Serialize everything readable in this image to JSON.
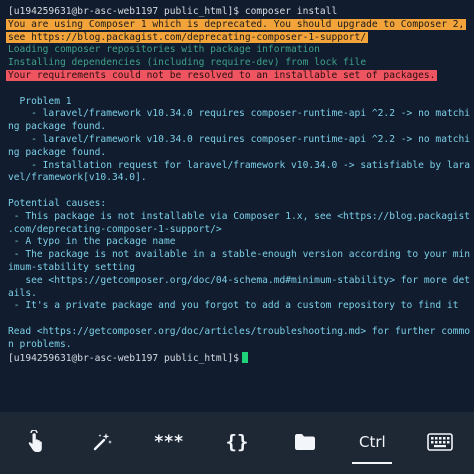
{
  "terminal": {
    "lines": [
      {
        "text": "[u194259631@br-asc-web1197 public_html]$ composer install",
        "style": "plain"
      },
      {
        "text": "You are using Composer 1 which is deprecated. You should upgrade to Composer 2,",
        "style": "warn"
      },
      {
        "text": "see https://blog.packagist.com/deprecating-composer-1-support/",
        "style": "warn"
      },
      {
        "text": "Loading composer repositories with package information",
        "style": "dim"
      },
      {
        "text": "Installing dependencies (including require-dev) from lock file",
        "style": "dim"
      },
      {
        "text": "Your requirements could not be resolved to an installable set of packages.",
        "style": "err"
      },
      {
        "text": "",
        "style": "plain"
      },
      {
        "text": "  Problem 1",
        "style": "cyan"
      },
      {
        "text": "    - laravel/framework v10.34.0 requires composer-runtime-api ^2.2 -> no matchi",
        "style": "cyan"
      },
      {
        "text": "ng package found.",
        "style": "cyan"
      },
      {
        "text": "    - laravel/framework v10.34.0 requires composer-runtime-api ^2.2 -> no matchi",
        "style": "cyan"
      },
      {
        "text": "ng package found.",
        "style": "cyan"
      },
      {
        "text": "    - Installation request for laravel/framework v10.34.0 -> satisfiable by lara",
        "style": "cyan"
      },
      {
        "text": "vel/framework[v10.34.0].",
        "style": "cyan"
      },
      {
        "text": "",
        "style": "plain"
      },
      {
        "text": "Potential causes:",
        "style": "cyan"
      },
      {
        "text": " - This package is not installable via Composer 1.x, see <https://blog.packagist",
        "style": "cyan"
      },
      {
        "text": ".com/deprecating-composer-1-support/>",
        "style": "cyan"
      },
      {
        "text": " - A typo in the package name",
        "style": "cyan"
      },
      {
        "text": " - The package is not available in a stable-enough version according to your min",
        "style": "cyan"
      },
      {
        "text": "imum-stability setting",
        "style": "cyan"
      },
      {
        "text": "   see <https://getcomposer.org/doc/04-schema.md#minimum-stability> for more det",
        "style": "cyan"
      },
      {
        "text": "ails.",
        "style": "cyan"
      },
      {
        "text": " - It's a private package and you forgot to add a custom repository to find it",
        "style": "cyan"
      },
      {
        "text": "",
        "style": "plain"
      },
      {
        "text": "Read <https://getcomposer.org/doc/articles/troubleshooting.md> for further commo",
        "style": "cyan"
      },
      {
        "text": "n problems.",
        "style": "cyan"
      },
      {
        "text": "[u194259631@br-asc-web1197 public_html]$",
        "style": "prompt"
      }
    ]
  },
  "toolbar": {
    "buttons": [
      {
        "name": "touch-icon-button",
        "icon": "touch-icon"
      },
      {
        "name": "magic-wand-icon-button",
        "icon": "magic-wand-icon"
      },
      {
        "name": "password-button",
        "label": "***"
      },
      {
        "name": "snippets-button",
        "label": "{}"
      },
      {
        "name": "folder-icon-button",
        "icon": "folder-icon"
      },
      {
        "name": "ctrl-button",
        "label": "Ctrl"
      },
      {
        "name": "keyboard-icon-button",
        "icon": "keyboard-icon"
      }
    ]
  },
  "colors": {
    "background": "#111d2e",
    "toolbar": "#1e2734",
    "warning_highlight": "#f2a33a",
    "error_highlight": "#ef5461",
    "dim_text": "#3fa089",
    "info_text": "#7ccfe8",
    "cursor": "#1fd37a"
  }
}
